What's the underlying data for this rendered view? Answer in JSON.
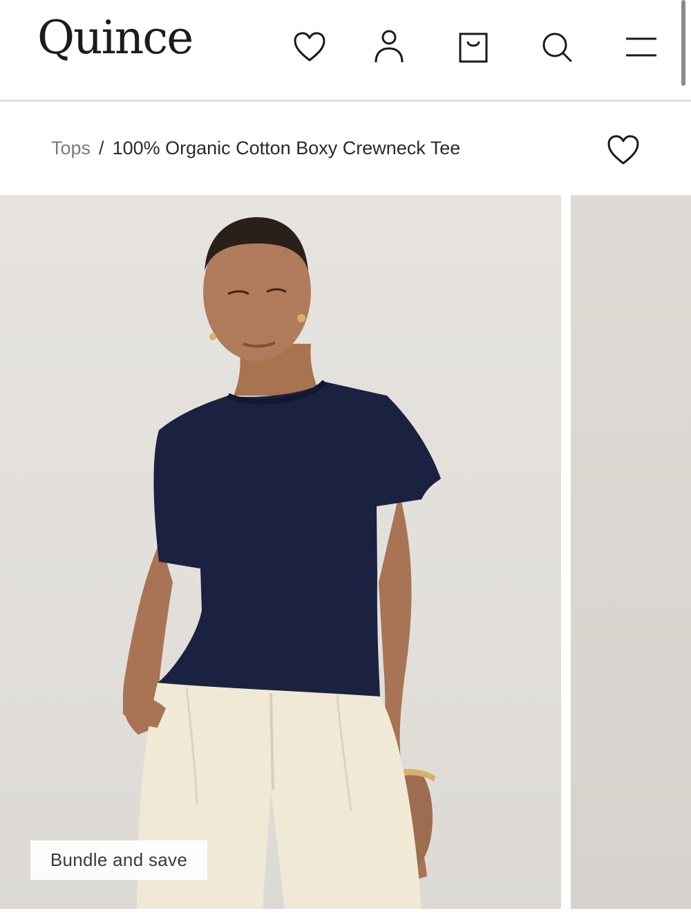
{
  "header": {
    "logo": "Quince",
    "icons": [
      "heart-icon",
      "account-icon",
      "bag-icon",
      "search-icon",
      "menu-icon"
    ]
  },
  "breadcrumb": {
    "parent": "Tops",
    "separator": "/",
    "current": "100% Organic Cotton Boxy Crewneck Tee"
  },
  "gallery": {
    "badge": "Bundle and save"
  },
  "colors": {
    "tee": "#1b2140",
    "pants": "#efe9d6",
    "background": "#e4e1dd",
    "skin": "#b07a5c"
  }
}
